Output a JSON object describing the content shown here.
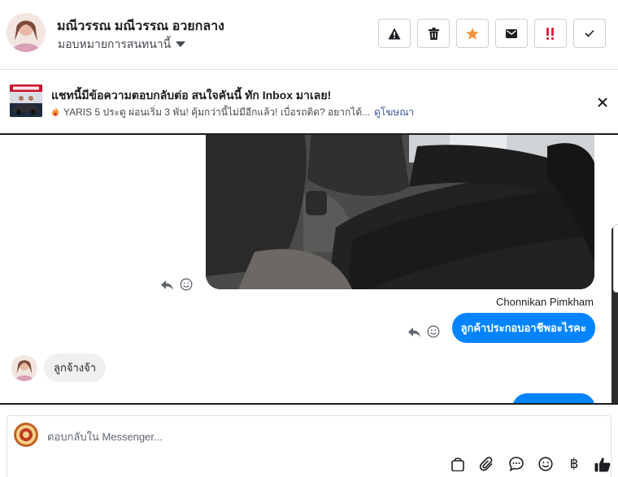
{
  "header": {
    "contact_name": "มณีวรรณ มณีวรรณ อวยกลาง",
    "assign_label": "มอบหมายการสนทนานี้",
    "actions": [
      {
        "icon": "warning-icon",
        "color": "#1c1e21"
      },
      {
        "icon": "trash-icon",
        "color": "#1c1e21"
      },
      {
        "icon": "star-icon",
        "color": "#f7923b"
      },
      {
        "icon": "envelope-icon",
        "color": "#1c1e21"
      },
      {
        "icon": "priority-icon",
        "color": "#e41e3f"
      },
      {
        "icon": "check-icon",
        "color": "#1c1e21"
      }
    ]
  },
  "ad": {
    "title": "แชทนี้มีข้อความตอบกลับต่อ สนใจคันนี้ ทัก Inbox มาเลย!",
    "subtitle": "YARIS 5 ประตู ผ่อนเริ่ม 3 พัน! คุ้มกว่านี้ไม่มีอีกแล้ว! เบื่อรถติด? อยากได้...",
    "link": "ดูโฆษณา",
    "thumb_caption": "YARIS"
  },
  "conversation": {
    "sender_name": "Chonnikan Pimkham",
    "outgoing_message": "ลูกค้าประกอบอาชีพอะไรคะ",
    "incoming_message": "ลูกจ้างจ้า"
  },
  "composer": {
    "placeholder": "ตอบกลับใน Messenger...",
    "tools": [
      "bag-icon",
      "paperclip-icon",
      "chat-bubble-icon",
      "emoji-icon",
      "baht-icon",
      "thumbs-up-icon"
    ],
    "baht_symbol": "฿"
  },
  "colors": {
    "messenger_blue": "#0084ff",
    "incoming_bubble": "#f1f0f0",
    "link": "#385898"
  }
}
